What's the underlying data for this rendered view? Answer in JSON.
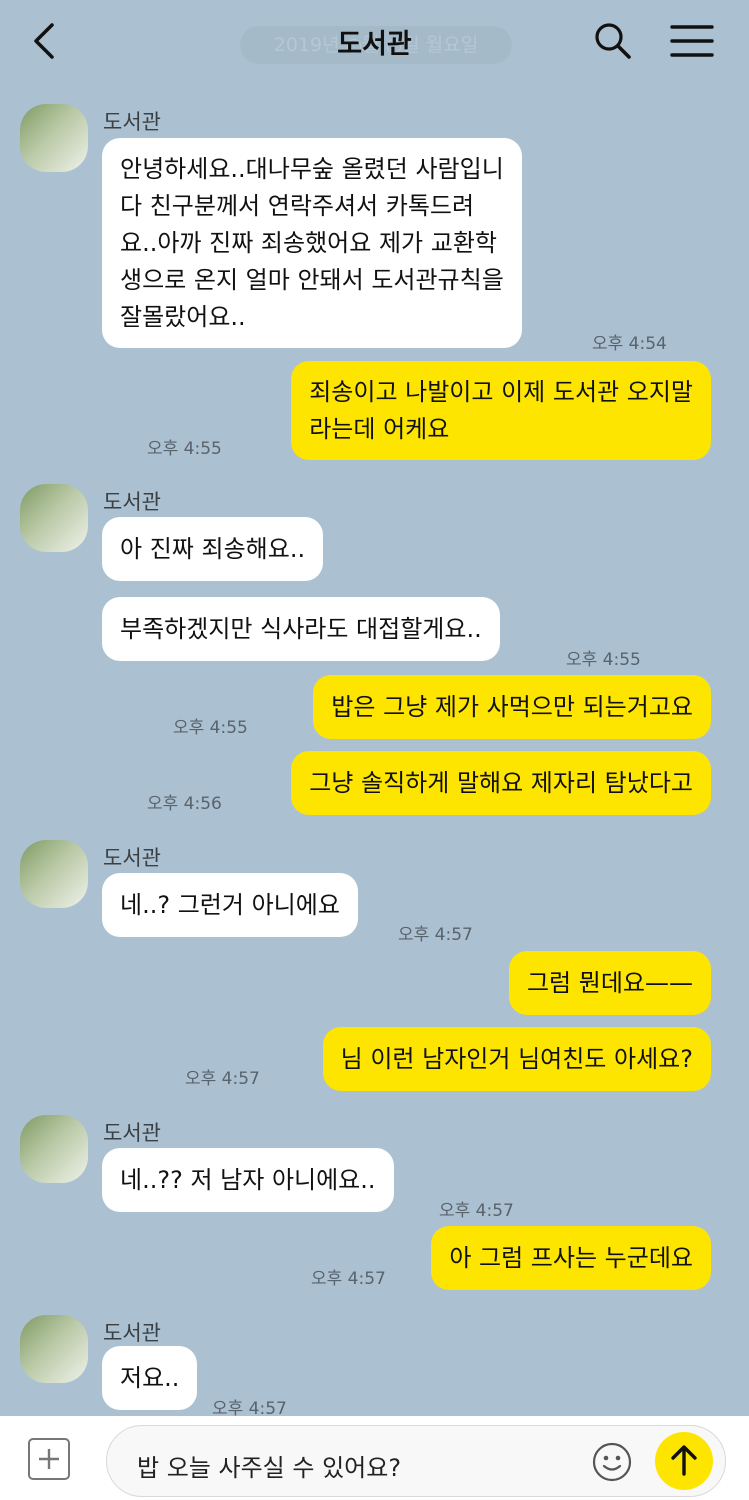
{
  "header": {
    "title": "도서관",
    "date_divider": "2019년 ○월 ○일 월요일",
    "back_icon": "chevron-left-icon",
    "search_icon": "search-icon",
    "menu_icon": "menu-icon"
  },
  "colors": {
    "background": "#abc1d1",
    "incoming_bubble": "#ffffff",
    "outgoing_bubble": "#fee500"
  },
  "messages": [
    {
      "sender": "도서관",
      "text": "안녕하세요..대나무숲 올렸던 사람입니\n다 친구분께서 연락주셔서 카톡드려\n요..아까 진짜 죄송했어요 제가 교환학\n생으로 온지 얼마 안돼서 도서관규칙을\n잘몰랐어요..",
      "time": "오후 4:54"
    },
    {
      "sender": "me",
      "text": "죄송이고 나발이고 이제 도서관 오지말\n라는데 어케요",
      "time": "오후 4:55"
    },
    {
      "sender": "도서관",
      "text": "아 진짜 죄송해요..",
      "time": ""
    },
    {
      "sender": "도서관",
      "text": "부족하겠지만 식사라도 대접할게요..",
      "time": "오후 4:55"
    },
    {
      "sender": "me",
      "text": "밥은 그냥 제가 사먹으만 되는거고요",
      "time": "오후 4:55"
    },
    {
      "sender": "me",
      "text": "그냥 솔직하게 말해요 제자리 탐났다고",
      "time": "오후 4:56"
    },
    {
      "sender": "도서관",
      "text": "네..? 그런거 아니에요",
      "time": "오후 4:57"
    },
    {
      "sender": "me",
      "text": "그럼 뭔데요——",
      "time": ""
    },
    {
      "sender": "me",
      "text": "님 이런 남자인거 님여친도 아세요?",
      "time": "오후 4:57"
    },
    {
      "sender": "도서관",
      "text": "네..?? 저 남자 아니에요..",
      "time": "오후 4:57"
    },
    {
      "sender": "me",
      "text": "아 그럼 프사는 누군데요",
      "time": "오후 4:57"
    },
    {
      "sender": "도서관",
      "text": "저요..",
      "time": "오후 4:57"
    }
  ],
  "input": {
    "value": "밥 오늘 사주실 수 있어요?",
    "plus_icon": "plus-icon",
    "emoji_icon": "emoji-icon",
    "send_icon": "send-arrow-icon"
  }
}
